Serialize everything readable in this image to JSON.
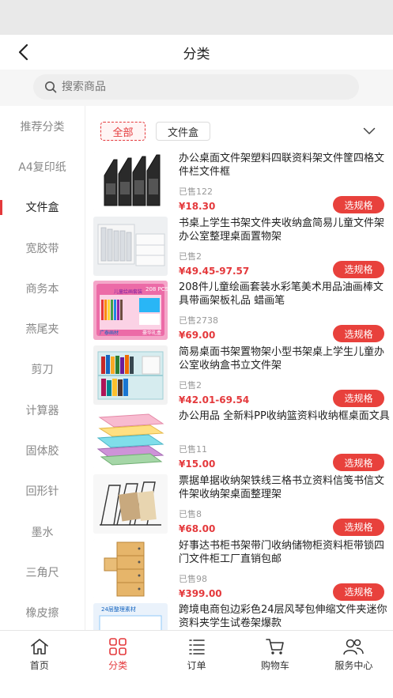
{
  "nav": {
    "title": "分类"
  },
  "search": {
    "placeholder": "搜索商品"
  },
  "sidebar": {
    "items": [
      {
        "label": "推荐分类"
      },
      {
        "label": "A4复印纸"
      },
      {
        "label": "文件盒",
        "active": true
      },
      {
        "label": "宽胶带"
      },
      {
        "label": "商务本"
      },
      {
        "label": "燕尾夹"
      },
      {
        "label": "剪刀"
      },
      {
        "label": "计算器"
      },
      {
        "label": "固体胶"
      },
      {
        "label": "回形针"
      },
      {
        "label": "墨水"
      },
      {
        "label": "三角尺"
      },
      {
        "label": "橡皮擦"
      }
    ]
  },
  "filters": {
    "all": "全部",
    "current": "文件盒"
  },
  "products": [
    {
      "name": "办公桌面文件架塑料四联资料架文件筐四格文件栏文件框",
      "sold": "已售122",
      "price": "¥18.30",
      "button": "选规格"
    },
    {
      "name": "书桌上学生书架文件夹收纳盒简易儿童文件架办公室整理桌面置物架",
      "sold": "已售2",
      "price": "¥49.45-97.57",
      "button": "选规格"
    },
    {
      "name": "208件儿童绘画套装水彩笔美术用品油画棒文具带画架板礼品 蜡画笔",
      "sold": "已售2738",
      "price": "¥69.00",
      "button": "选规格",
      "thumb_text": [
        "208 PCS",
        "儿童绘画套装",
        "广泰画材",
        "豪华礼盒"
      ]
    },
    {
      "name": "简易桌面书架置物架小型书架桌上学生儿童办公室收纳盒书立文件架",
      "sold": "已售2",
      "price": "¥42.01-69.54",
      "button": "选规格"
    },
    {
      "name": "办公用品 全新料PP收纳篮资料收纳框桌面文具",
      "sold": "已售11",
      "price": "¥15.00",
      "button": "选规格"
    },
    {
      "name": "票据单据收纳架铁线三格书立资料信笺书信文件架收纳架桌面整理架",
      "sold": "已售8",
      "price": "¥68.00",
      "button": "选规格"
    },
    {
      "name": "好事达书柜书架带门收纳储物柜资料柜带锁四门文件柜工厂直销包邮",
      "sold": "已售98",
      "price": "¥399.00",
      "button": "选规格"
    },
    {
      "name": "跨境电商包边彩色24层风琴包伸缩文件夹迷你资料夹学生试卷架爆款",
      "sold": "",
      "price": "",
      "button": "",
      "thumb_text": [
        "24层整理素材"
      ]
    }
  ],
  "tabbar": {
    "items": [
      {
        "label": "首页",
        "icon": "home-icon"
      },
      {
        "label": "分类",
        "icon": "category-icon",
        "active": true
      },
      {
        "label": "订单",
        "icon": "order-list-icon"
      },
      {
        "label": "购物车",
        "icon": "cart-icon"
      },
      {
        "label": "服务中心",
        "icon": "service-icon"
      }
    ]
  },
  "colors": {
    "accent": "#e4393c",
    "button": "#e8413c"
  }
}
